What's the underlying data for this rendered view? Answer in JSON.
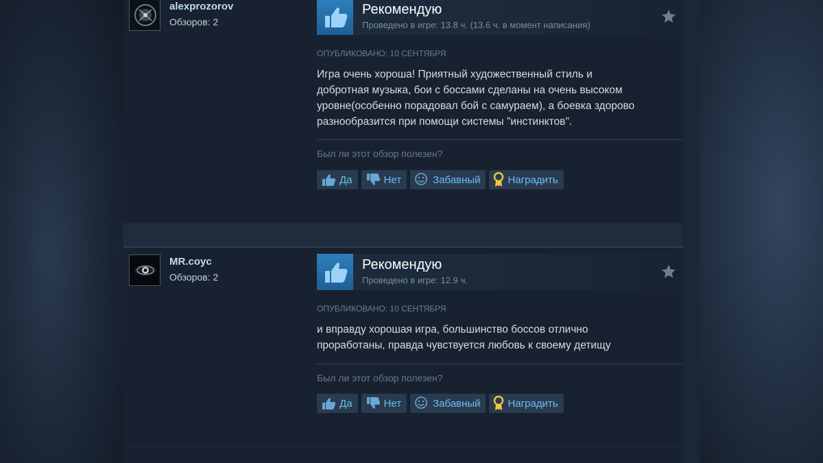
{
  "reviews": [
    {
      "author": "alexprozorov",
      "review_count": "Обзоров: 2",
      "recommendation": "Рекомендую",
      "hours": "Проведено в игре: 13.8 ч. (13.6 ч. в момент написания)",
      "posted": "Опубликовано: 10 сентября",
      "text_lines": [
        "Игра очень хороша! Приятный художественный стиль и",
        "добротная музыка, бои с боссами сделаны на очень высоком",
        "уровне(особенно порадовал бой с самураем), а боевка здорово",
        "разнообразится при помощи системы \"инстинктов\"."
      ],
      "helpful_question": "Был ли этот обзор полезен?",
      "buttons": {
        "yes": "Да",
        "no": "Нет",
        "funny": "Забавный",
        "award": "Наградить"
      }
    },
    {
      "author": "MR.coyc",
      "review_count": "Обзоров: 2",
      "recommendation": "Рекомендую",
      "hours": "Проведено в игре: 12.9 ч.",
      "posted": "Опубликовано: 10 сентября",
      "text_lines": [
        "и вправду хорошая игра, большинство боссов отлично",
        "проработаны, правда чувствуется любовь к своему детищу"
      ],
      "helpful_question": "Был ли этот обзор полезен?",
      "buttons": {
        "yes": "Да",
        "no": "Нет",
        "funny": "Забавный",
        "award": "Наградить"
      }
    }
  ],
  "colors": {
    "page_bg": "#1f2c3d",
    "card_bg": "#17212f",
    "link_blue": "#66c0f4",
    "thumb_blue": "#2e7fbd"
  },
  "icons": [
    "thumbs-up-icon",
    "thumbs-down-icon",
    "smiley-icon",
    "award-medal-icon",
    "star-icon"
  ]
}
